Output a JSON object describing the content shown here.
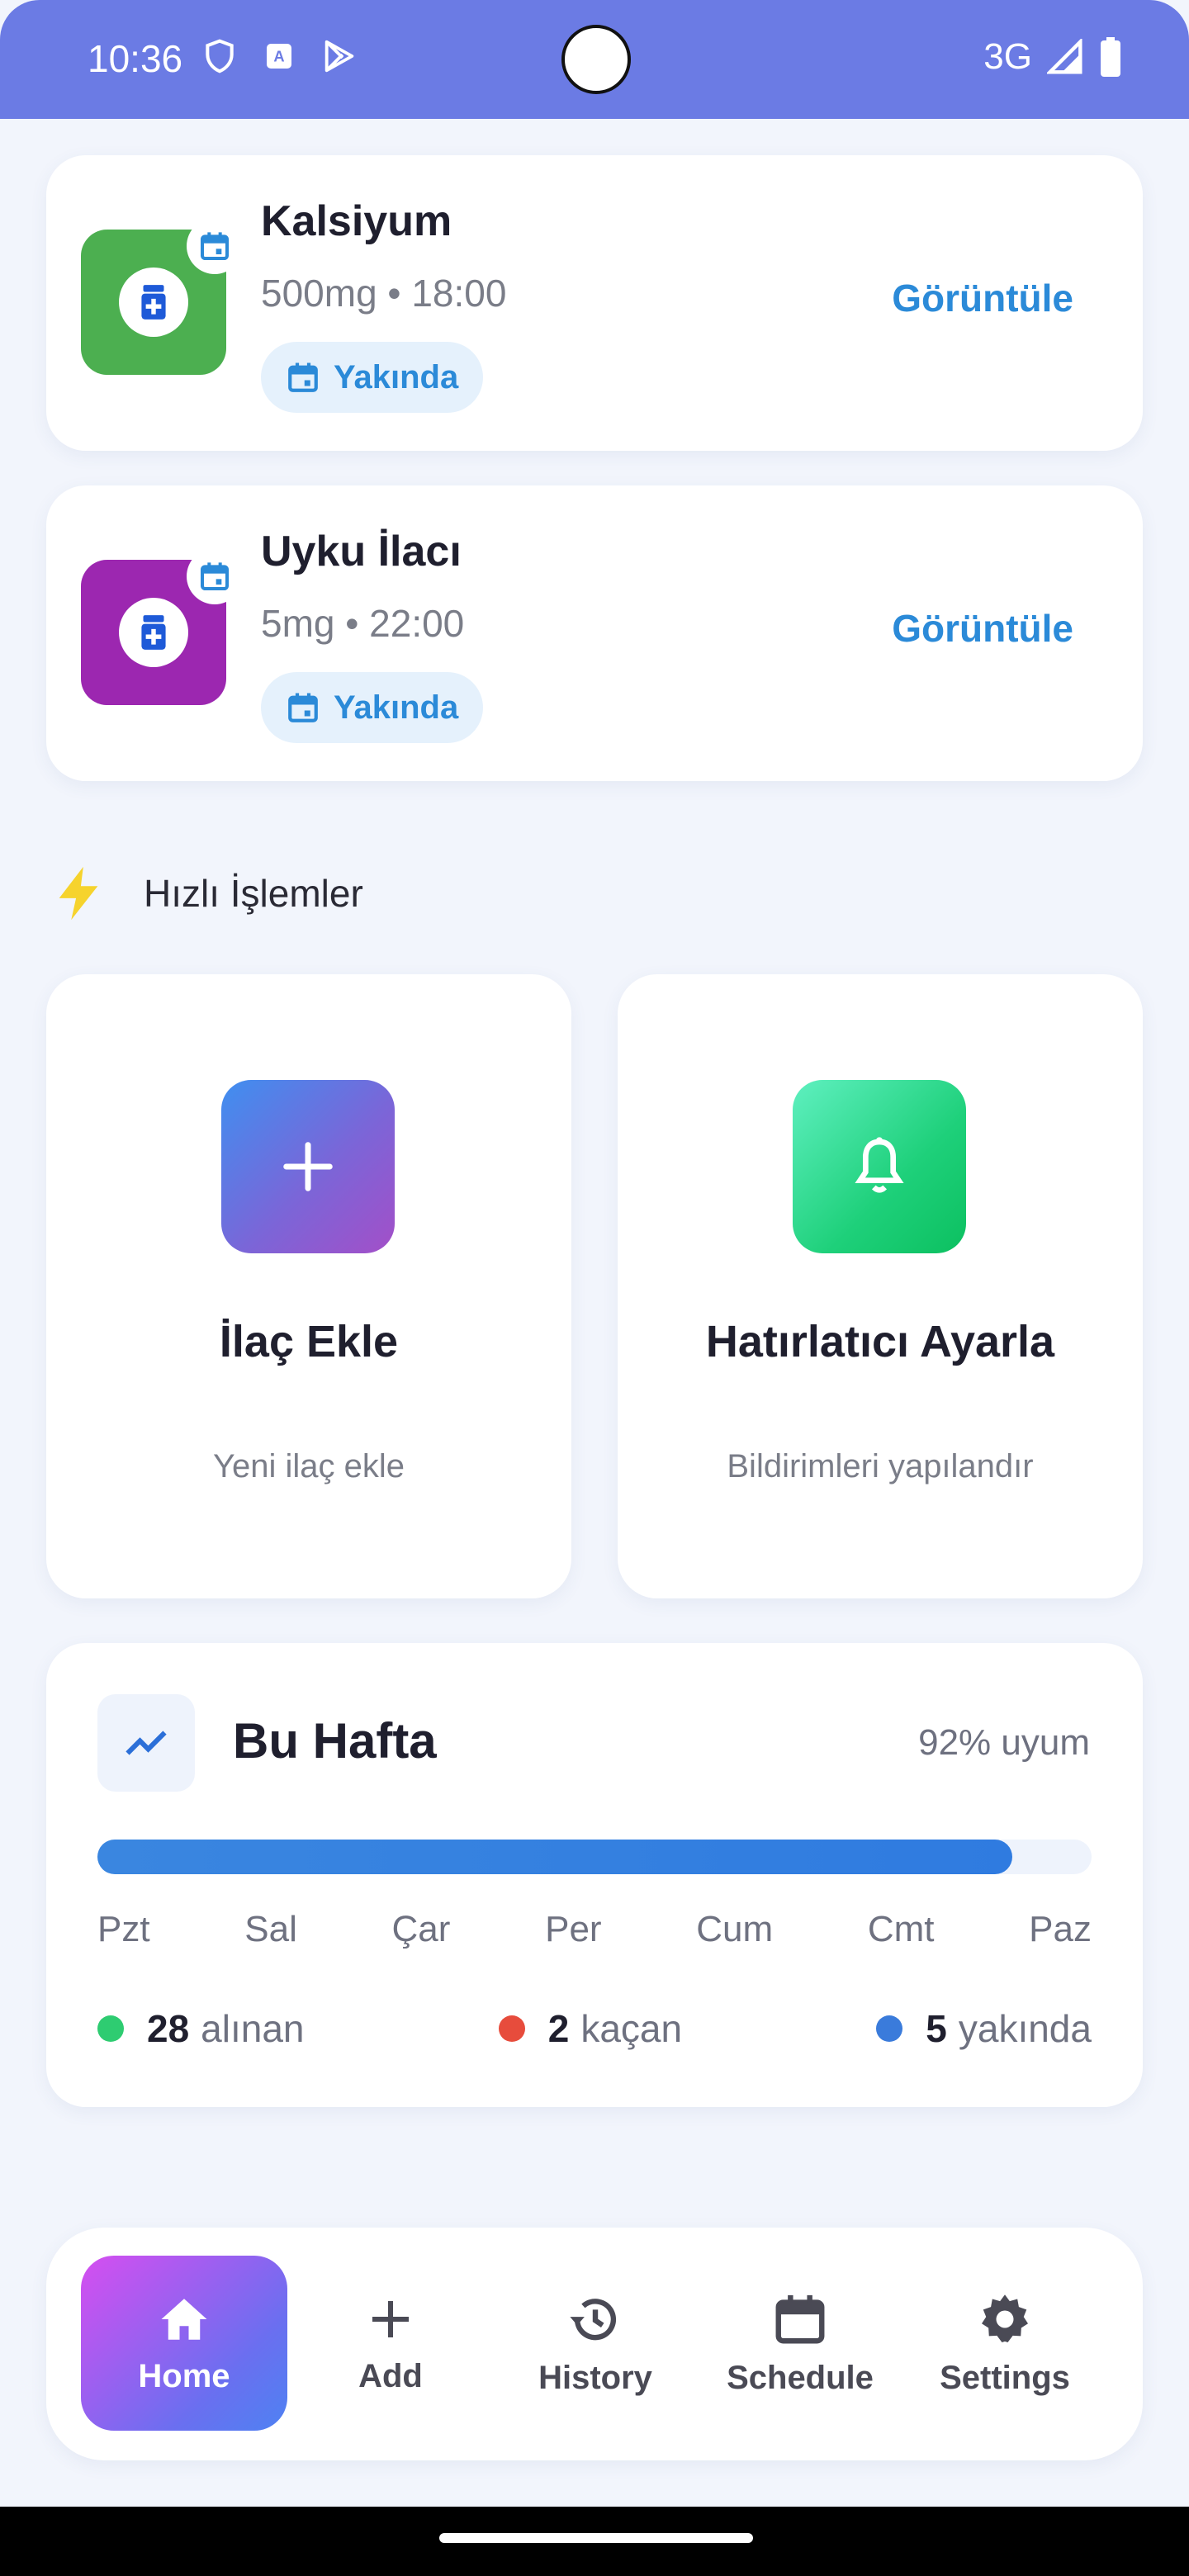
{
  "status_bar": {
    "time": "10:36",
    "network": "3G"
  },
  "medications": [
    {
      "name": "Kalsiyum",
      "dose_time": "500mg • 18:00",
      "status": "Yakında",
      "action": "Görüntüle",
      "color": "#4caf50"
    },
    {
      "name": "Uyku İlacı",
      "dose_time": "5mg • 22:00",
      "status": "Yakında",
      "action": "Görüntüle",
      "color": "#9c27b0"
    }
  ],
  "quick_actions": {
    "title": "Hızlı İşlemler",
    "items": [
      {
        "title": "İlaç Ekle",
        "subtitle": "Yeni ilaç ekle",
        "icon": "plus-icon"
      },
      {
        "title": "Hatırlatıcı Ayarla",
        "subtitle": "Bildirimleri yapılandır",
        "icon": "bell-icon"
      }
    ]
  },
  "week": {
    "title": "Bu Hafta",
    "adherence": "92% uyum",
    "progress": 0.92,
    "days": [
      "Pzt",
      "Sal",
      "Çar",
      "Per",
      "Cum",
      "Cmt",
      "Paz"
    ],
    "stats": [
      {
        "count": "28",
        "label": "alınan",
        "color": "#2ecc71"
      },
      {
        "count": "2",
        "label": "kaçan",
        "color": "#e74c3c"
      },
      {
        "count": "5",
        "label": "yakında",
        "color": "#3a7bdb"
      }
    ]
  },
  "nav": {
    "items": [
      {
        "label": "Home",
        "icon": "home-icon",
        "active": true
      },
      {
        "label": "Add",
        "icon": "plus-icon"
      },
      {
        "label": "History",
        "icon": "history-icon"
      },
      {
        "label": "Schedule",
        "icon": "calendar-icon"
      },
      {
        "label": "Settings",
        "icon": "gear-icon"
      }
    ]
  },
  "colors": {
    "accent": "#2b8ad8",
    "status_bar": "#6b7be4",
    "background": "#f2f5fc"
  }
}
